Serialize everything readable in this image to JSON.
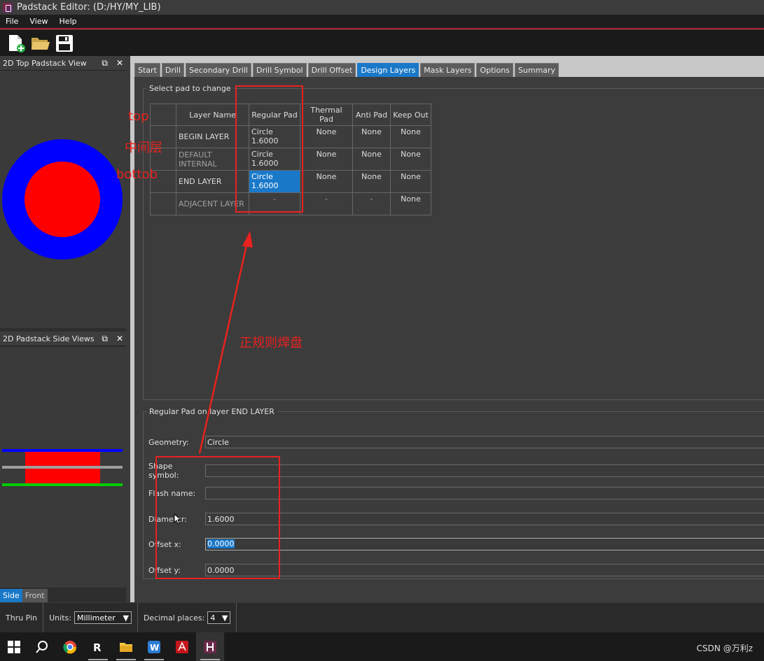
{
  "window": {
    "title": "Padstack Editor:  (D:/HY/MY_LIB)"
  },
  "menu": {
    "items": [
      "File",
      "View",
      "Help"
    ]
  },
  "toolbar": {
    "buttons": [
      "new-icon",
      "open-folder-icon",
      "save-icon"
    ]
  },
  "left": {
    "top_view_title": "2D Top Padstack View",
    "side_view_title": "2D Padstack Side Views",
    "view_tabs": [
      "Side",
      "Front"
    ],
    "colors": {
      "outer": "#0000ff",
      "inner": "#ff0000",
      "top_line": "#0000ff",
      "mid_line": "#9e9e9e",
      "bottom_line": "#00cc00"
    }
  },
  "tabs": [
    "Start",
    "Drill",
    "Secondary Drill",
    "Drill Symbol",
    "Drill Offset",
    "Design Layers",
    "Mask Layers",
    "Options",
    "Summary"
  ],
  "active_tab": "Design Layers",
  "select_pad": {
    "legend": "Select pad to change",
    "headers": [
      "Layer Name",
      "Regular Pad",
      "Thermal Pad",
      "Anti Pad",
      "Keep Out"
    ],
    "rows": [
      {
        "layer": "BEGIN LAYER",
        "regular": "Circle 1.6000",
        "thermal": "None",
        "anti": "None",
        "keep": "None"
      },
      {
        "layer": "DEFAULT INTERNAL",
        "regular": "Circle 1.6000",
        "thermal": "None",
        "anti": "None",
        "keep": "None"
      },
      {
        "layer": "END LAYER",
        "regular": "Circle 1.6000",
        "thermal": "None",
        "anti": "None",
        "keep": "None"
      },
      {
        "layer": "ADJACENT LAYER",
        "regular": "-",
        "thermal": "-",
        "anti": "-",
        "keep": "None"
      }
    ]
  },
  "regular_pad": {
    "legend": "Regular Pad on layer END LAYER",
    "geometry_label": "Geometry:",
    "geometry_value": "Circle",
    "shape_label": "Shape symbol:",
    "shape_value": "",
    "flash_label": "Flash name:",
    "flash_value": "",
    "diameter_label": "Diameter:",
    "diameter_value": "1.6000",
    "offset_x_label": "Offset x:",
    "offset_x_value": "0.0000",
    "offset_y_label": "Offset y:",
    "offset_y_value": "0.0000"
  },
  "status": {
    "type": "Thru Pin",
    "units_label": "Units:",
    "units_value": "Millimeter",
    "decimal_label": "Decimal places:",
    "decimal_value": "4"
  },
  "annotations": {
    "top": "top",
    "middle": "中间层",
    "bottom": "bottob",
    "regular_pad": "正规则焊盘",
    "color": "#e8221f"
  },
  "watermark": "CSDN @万利z"
}
